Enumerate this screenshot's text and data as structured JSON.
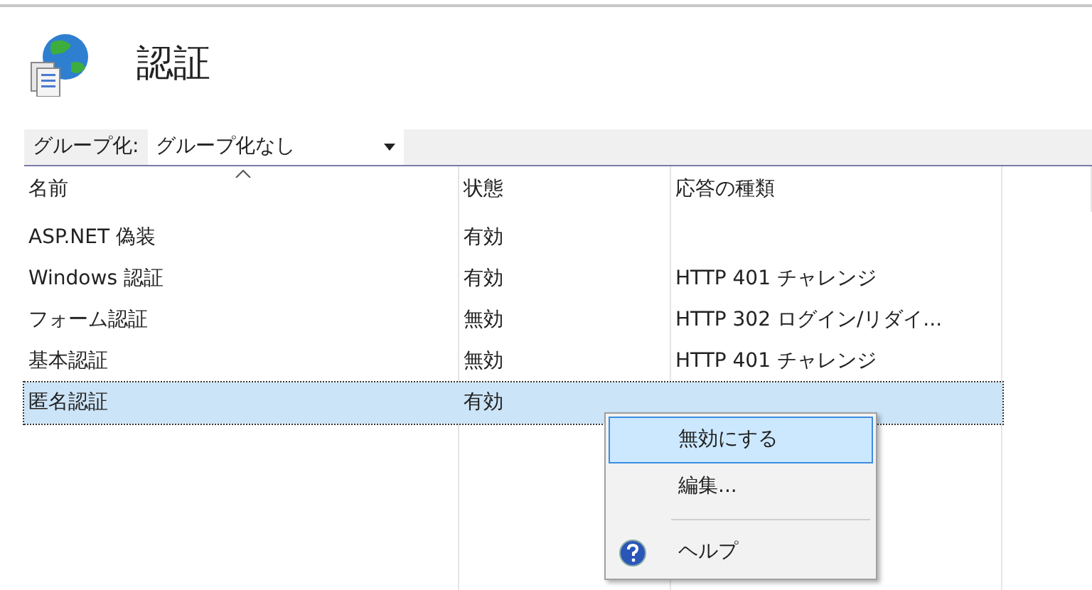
{
  "title": "認証",
  "group_by": {
    "label": "グループ化:",
    "value": "グループ化なし"
  },
  "table": {
    "columns": [
      "名前",
      "状態",
      "応答の種類"
    ],
    "rows": [
      {
        "cells": [
          "ASP.NET 偽装",
          "有効",
          ""
        ],
        "selected": false
      },
      {
        "cells": [
          "Windows 認証",
          "有効",
          "HTTP 401 チャレンジ"
        ],
        "selected": false
      },
      {
        "cells": [
          "フォーム認証",
          "無効",
          "HTTP 302 ログイン/リダイ..."
        ],
        "selected": false
      },
      {
        "cells": [
          "基本認証",
          "無効",
          "HTTP 401 チャレンジ"
        ],
        "selected": false
      },
      {
        "cells": [
          "匿名認証",
          "有効",
          ""
        ],
        "selected": true
      }
    ]
  },
  "context_menu": [
    {
      "label": "無効にする",
      "kind": "item",
      "selected": true
    },
    {
      "label": "編集...",
      "kind": "item",
      "selected": false
    },
    {
      "label": "ヘルプ",
      "kind": "help",
      "selected": false
    }
  ]
}
